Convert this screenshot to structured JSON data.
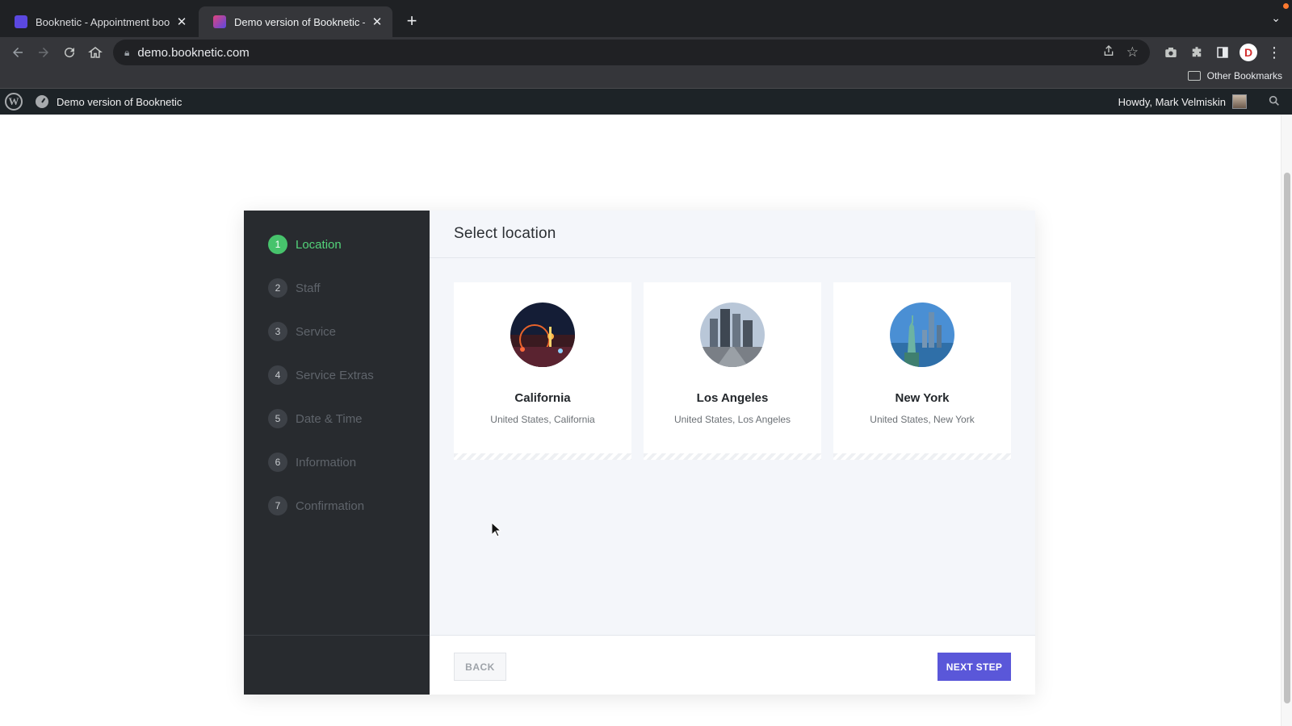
{
  "browser": {
    "tabs": [
      {
        "title": "Booknetic - Appointment book",
        "favicon_color": "#5b48e0",
        "active": false
      },
      {
        "title": "Demo version of Booknetic – D",
        "favicon_color": "#7a4fd8",
        "active": true
      }
    ],
    "url": "demo.booknetic.com",
    "bookmarks_other": "Other Bookmarks",
    "profile_initial": "D"
  },
  "wp_admin_bar": {
    "site_name": "Demo version of Booknetic",
    "greeting": "Howdy, Mark Velmiskin"
  },
  "booking": {
    "steps": [
      {
        "num": "1",
        "label": "Location",
        "active": true
      },
      {
        "num": "2",
        "label": "Staff",
        "active": false
      },
      {
        "num": "3",
        "label": "Service",
        "active": false
      },
      {
        "num": "4",
        "label": "Service Extras",
        "active": false
      },
      {
        "num": "5",
        "label": "Date & Time",
        "active": false
      },
      {
        "num": "6",
        "label": "Information",
        "active": false
      },
      {
        "num": "7",
        "label": "Confirmation",
        "active": false
      }
    ],
    "heading": "Select location",
    "locations": [
      {
        "name": "California",
        "address": "United States, California",
        "image": "night-fair-photo"
      },
      {
        "name": "Los Angeles",
        "address": "United States, Los Angeles",
        "image": "city-skyline-photo"
      },
      {
        "name": "New York",
        "address": "United States, New York",
        "image": "statue-of-liberty-photo"
      }
    ],
    "back_label": "BACK",
    "next_label": "NEXT STEP"
  },
  "colors": {
    "accent_green": "#47c36c",
    "primary_button": "#5a57d9",
    "sidebar_bg": "#282b2f"
  }
}
